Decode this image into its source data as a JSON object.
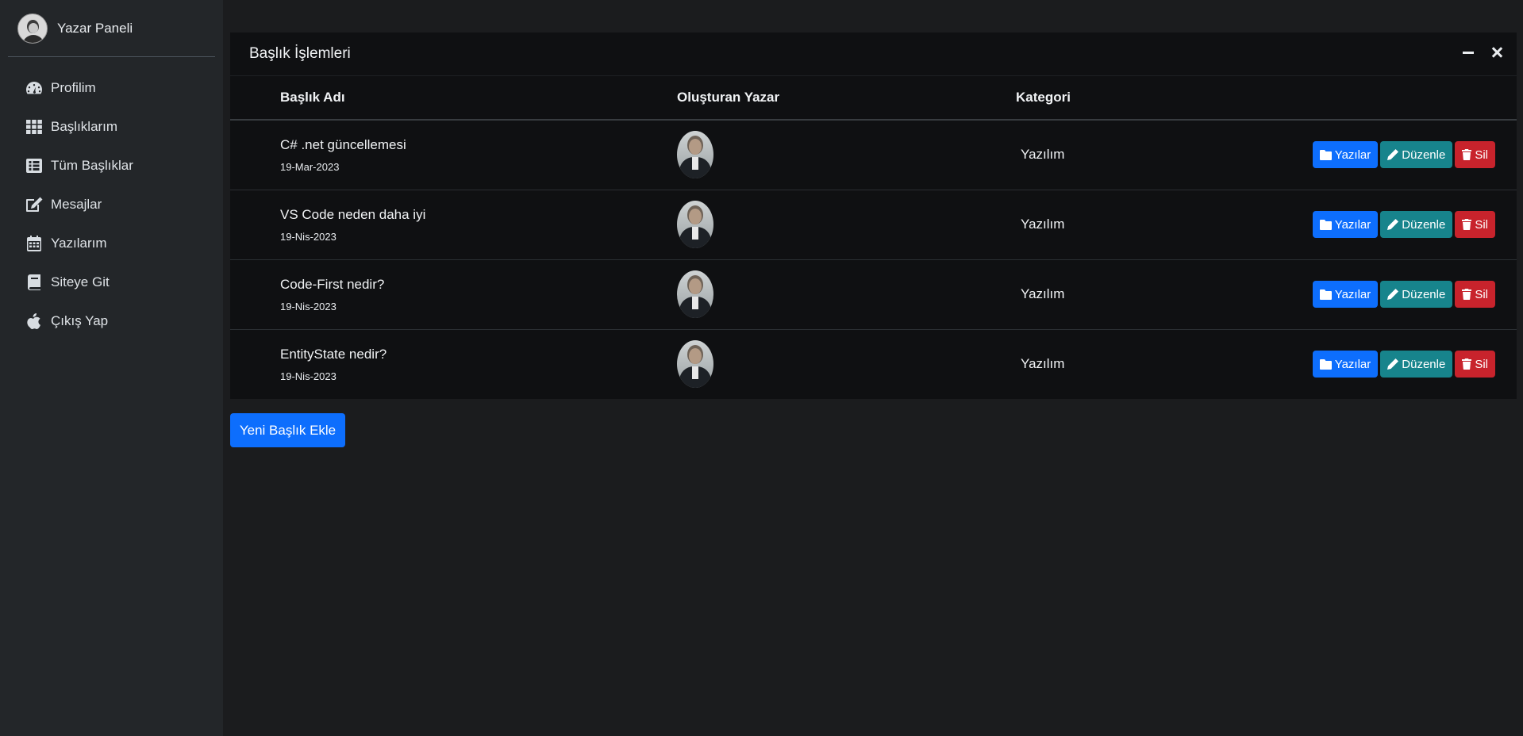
{
  "sidebar": {
    "brand_title": "Yazar Paneli",
    "items": [
      {
        "label": "Profilim",
        "icon": "dashboard-gauge-icon"
      },
      {
        "label": "Başlıklarım",
        "icon": "grid-icon"
      },
      {
        "label": "Tüm Başlıklar",
        "icon": "list-icon"
      },
      {
        "label": "Mesajlar",
        "icon": "edit-icon"
      },
      {
        "label": "Yazılarım",
        "icon": "calendar-icon"
      },
      {
        "label": "Siteye Git",
        "icon": "book-icon"
      },
      {
        "label": "Çıkış Yap",
        "icon": "apple-icon"
      }
    ]
  },
  "card": {
    "title": "Başlık İşlemleri",
    "columns": {
      "title": "Başlık Adı",
      "author": "Oluşturan Yazar",
      "category": "Kategori"
    },
    "rows": [
      {
        "title": "C# .net güncellemesi",
        "date": "19-Mar-2023",
        "category": "Yazılım"
      },
      {
        "title": "VS Code neden daha iyi",
        "date": "19-Nis-2023",
        "category": "Yazılım"
      },
      {
        "title": "Code-First nedir?",
        "date": "19-Nis-2023",
        "category": "Yazılım"
      },
      {
        "title": "EntityState nedir?",
        "date": "19-Nis-2023",
        "category": "Yazılım"
      }
    ],
    "buttons": {
      "posts": "Yazılar",
      "edit": "Düzenle",
      "delete": "Sil"
    }
  },
  "add_button": "Yeni Başlık Ekle",
  "colors": {
    "primary": "#0d6efd",
    "info": "#17848c",
    "danger": "#c8232c"
  }
}
